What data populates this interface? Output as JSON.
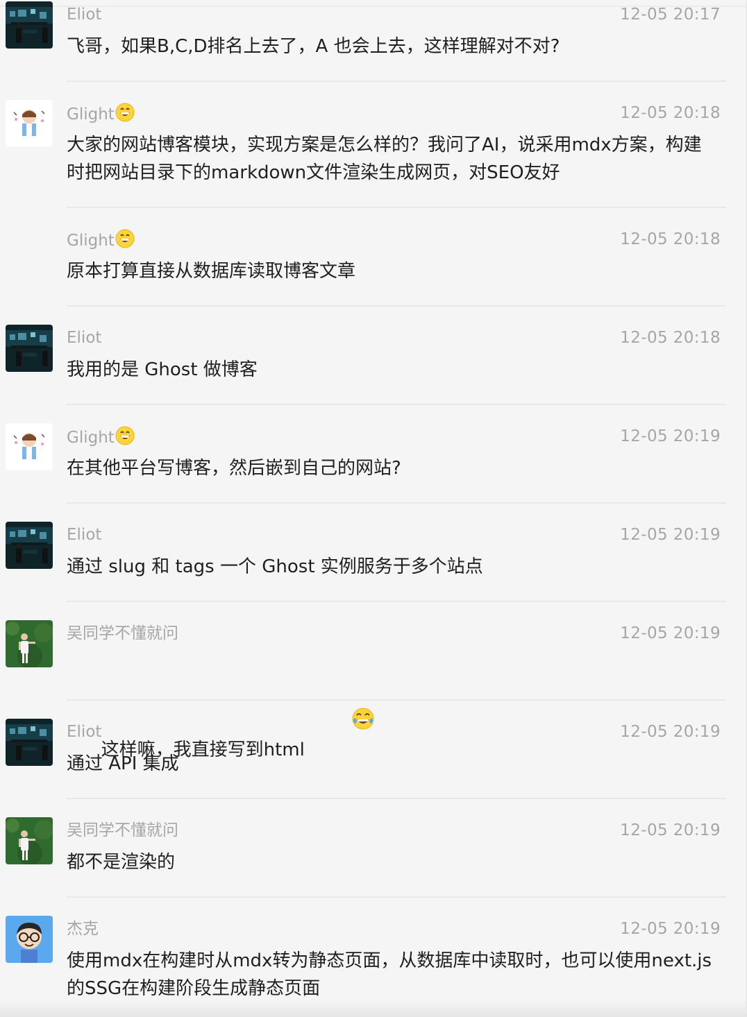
{
  "messages": [
    {
      "sender": "Eliot",
      "time": "12-05 20:17",
      "text": "飞哥，如果B,C,D排名上去了，A 也会上去，这样理解对不对?",
      "avatar_icon": "eliot-avatar-icon"
    },
    {
      "sender": "Glight",
      "sender_emoji": "grinning-face-icon",
      "time": "12-05 20:18",
      "text": "大家的网站博客模块，实现方案是怎么样的？我问了AI，说采用mdx方案，构建时把网站目录下的markdown文件渲染生成网页，对SEO友好",
      "avatar_icon": "glight-avatar-icon"
    },
    {
      "sender": "Glight",
      "sender_emoji": "grinning-face-icon",
      "time": "12-05 20:18",
      "text": "原本打算直接从数据库读取博客文章"
    },
    {
      "sender": "Eliot",
      "time": "12-05 20:18",
      "text": "我用的是 Ghost 做博客",
      "avatar_icon": "eliot-avatar-icon"
    },
    {
      "sender": "Glight",
      "sender_emoji": "grinning-face-icon",
      "time": "12-05 20:19",
      "text": "在其他平台写博客，然后嵌到自己的网站?",
      "avatar_icon": "glight-avatar-icon"
    },
    {
      "sender": "Eliot",
      "time": "12-05 20:19",
      "text": "通过 slug 和 tags 一个 Ghost 实例服务于多个站点",
      "avatar_icon": "eliot-avatar-icon"
    },
    {
      "sender": "吴同学不懂就问",
      "time": "12-05 20:19",
      "text": "这样嘛，我直接写到html",
      "text_emoji": "laughing-tears-icon",
      "avatar_icon": "wu-avatar-icon"
    },
    {
      "sender": "Eliot",
      "time": "12-05 20:19",
      "text": "通过 API 集成",
      "avatar_icon": "eliot-avatar-icon"
    },
    {
      "sender": "吴同学不懂就问",
      "time": "12-05 20:19",
      "text": "都不是渲染的",
      "avatar_icon": "wu-avatar-icon"
    },
    {
      "sender": "杰克",
      "time": "12-05 20:19",
      "text": "使用mdx在构建时从mdx转为静态页面，从数据库中读取时，也可以使用next.js的SSG在构建阶段生成静态页面",
      "avatar_icon": "jack-avatar-icon"
    }
  ],
  "colors": {
    "background": "#f5f5f5",
    "meta_text": "#a6a6a6",
    "body_text": "#1f1f1f",
    "divider": "#e7e7e7"
  }
}
